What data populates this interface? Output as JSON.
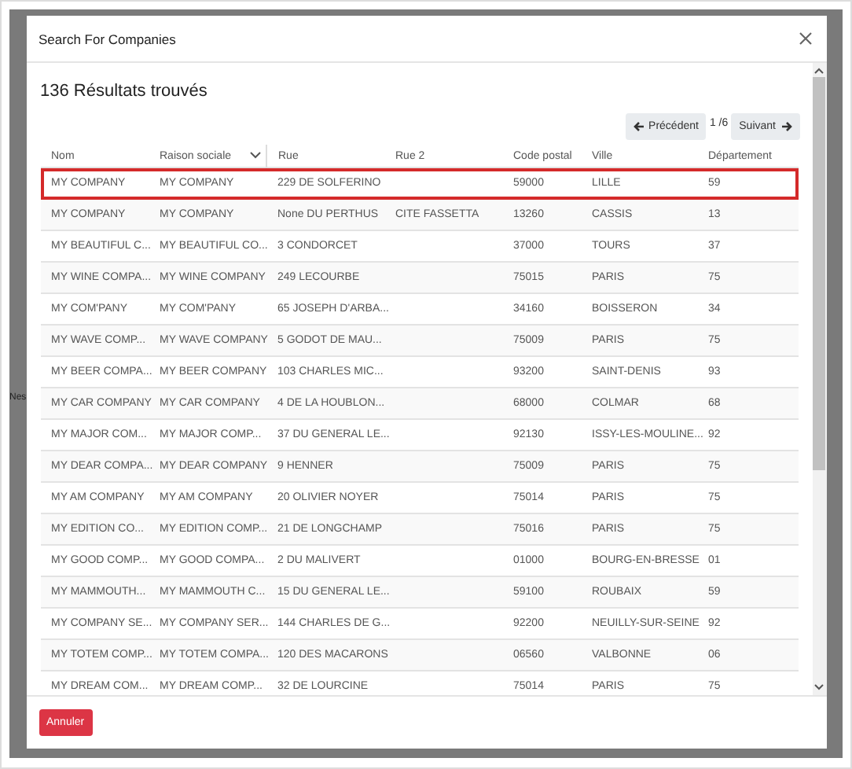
{
  "background_text": "Nes",
  "dialog": {
    "title": "Search For Companies",
    "results_title": "136 Résultats trouvés",
    "pagination": {
      "previous": "Précédent",
      "page": "1 /6",
      "next": "Suivant"
    },
    "cancel_button": "Annuler"
  },
  "table": {
    "columns": [
      {
        "label": "Nom",
        "sorted": false
      },
      {
        "label": "Raison sociale",
        "sorted": true
      },
      {
        "label": "Rue",
        "sorted": false
      },
      {
        "label": "Rue 2",
        "sorted": false
      },
      {
        "label": "Code postal",
        "sorted": false
      },
      {
        "label": "Ville",
        "sorted": false
      },
      {
        "label": "Département",
        "sorted": false
      }
    ],
    "rows": [
      {
        "selected": true,
        "cells": [
          "MY COMPANY",
          "MY COMPANY",
          "229 DE SOLFERINO",
          "",
          "59000",
          "LILLE",
          "59"
        ]
      },
      {
        "selected": false,
        "cells": [
          "MY COMPANY",
          "MY COMPANY",
          "None DU PERTHUS",
          "CITE FASSETTA",
          "13260",
          "CASSIS",
          "13"
        ]
      },
      {
        "selected": false,
        "cells": [
          "MY BEAUTIFUL C...",
          "MY BEAUTIFUL CO...",
          "3 CONDORCET",
          "",
          "37000",
          "TOURS",
          "37"
        ]
      },
      {
        "selected": false,
        "cells": [
          "MY WINE COMPA...",
          "MY WINE COMPANY",
          "249 LECOURBE",
          "",
          "75015",
          "PARIS",
          "75"
        ]
      },
      {
        "selected": false,
        "cells": [
          "MY COM'PANY",
          "MY COM'PANY",
          "65 JOSEPH D'ARBA...",
          "",
          "34160",
          "BOISSERON",
          "34"
        ]
      },
      {
        "selected": false,
        "cells": [
          "MY WAVE COMP...",
          "MY WAVE COMPANY",
          "5 GODOT DE MAU...",
          "",
          "75009",
          "PARIS",
          "75"
        ]
      },
      {
        "selected": false,
        "cells": [
          "MY BEER COMPA...",
          "MY BEER COMPANY",
          "103 CHARLES MIC...",
          "",
          "93200",
          "SAINT-DENIS",
          "93"
        ]
      },
      {
        "selected": false,
        "cells": [
          "MY CAR COMPANY",
          "MY CAR COMPANY",
          "4 DE LA HOUBLON...",
          "",
          "68000",
          "COLMAR",
          "68"
        ]
      },
      {
        "selected": false,
        "cells": [
          "MY MAJOR COM...",
          "MY MAJOR COMP...",
          "37 DU GENERAL LE...",
          "",
          "92130",
          "ISSY-LES-MOULINE...",
          "92"
        ]
      },
      {
        "selected": false,
        "cells": [
          "MY DEAR COMPA...",
          "MY DEAR COMPANY",
          "9 HENNER",
          "",
          "75009",
          "PARIS",
          "75"
        ]
      },
      {
        "selected": false,
        "cells": [
          "MY AM COMPANY",
          "MY AM COMPANY",
          "20 OLIVIER NOYER",
          "",
          "75014",
          "PARIS",
          "75"
        ]
      },
      {
        "selected": false,
        "cells": [
          "MY EDITION CO...",
          "MY EDITION COMP...",
          "21 DE LONGCHAMP",
          "",
          "75016",
          "PARIS",
          "75"
        ]
      },
      {
        "selected": false,
        "cells": [
          "MY GOOD COMP...",
          "MY GOOD COMPA...",
          "2 DU MALIVERT",
          "",
          "01000",
          "BOURG-EN-BRESSE",
          "01"
        ]
      },
      {
        "selected": false,
        "cells": [
          "MY MAMMOUTH...",
          "MY MAMMOUTH C...",
          "15 DU GENERAL LE...",
          "",
          "59100",
          "ROUBAIX",
          "59"
        ]
      },
      {
        "selected": false,
        "cells": [
          "MY COMPANY SE...",
          "MY COMPANY SER...",
          "144 CHARLES DE G...",
          "",
          "92200",
          "NEUILLY-SUR-SEINE",
          "92"
        ]
      },
      {
        "selected": false,
        "cells": [
          "MY TOTEM COMP...",
          "MY TOTEM COMPA...",
          "120 DES MACARONS",
          "",
          "06560",
          "VALBONNE",
          "06"
        ]
      },
      {
        "selected": false,
        "cells": [
          "MY DREAM COM...",
          "MY DREAM COMP...",
          "32 DE LOURCINE",
          "",
          "75014",
          "PARIS",
          "75"
        ]
      }
    ]
  }
}
